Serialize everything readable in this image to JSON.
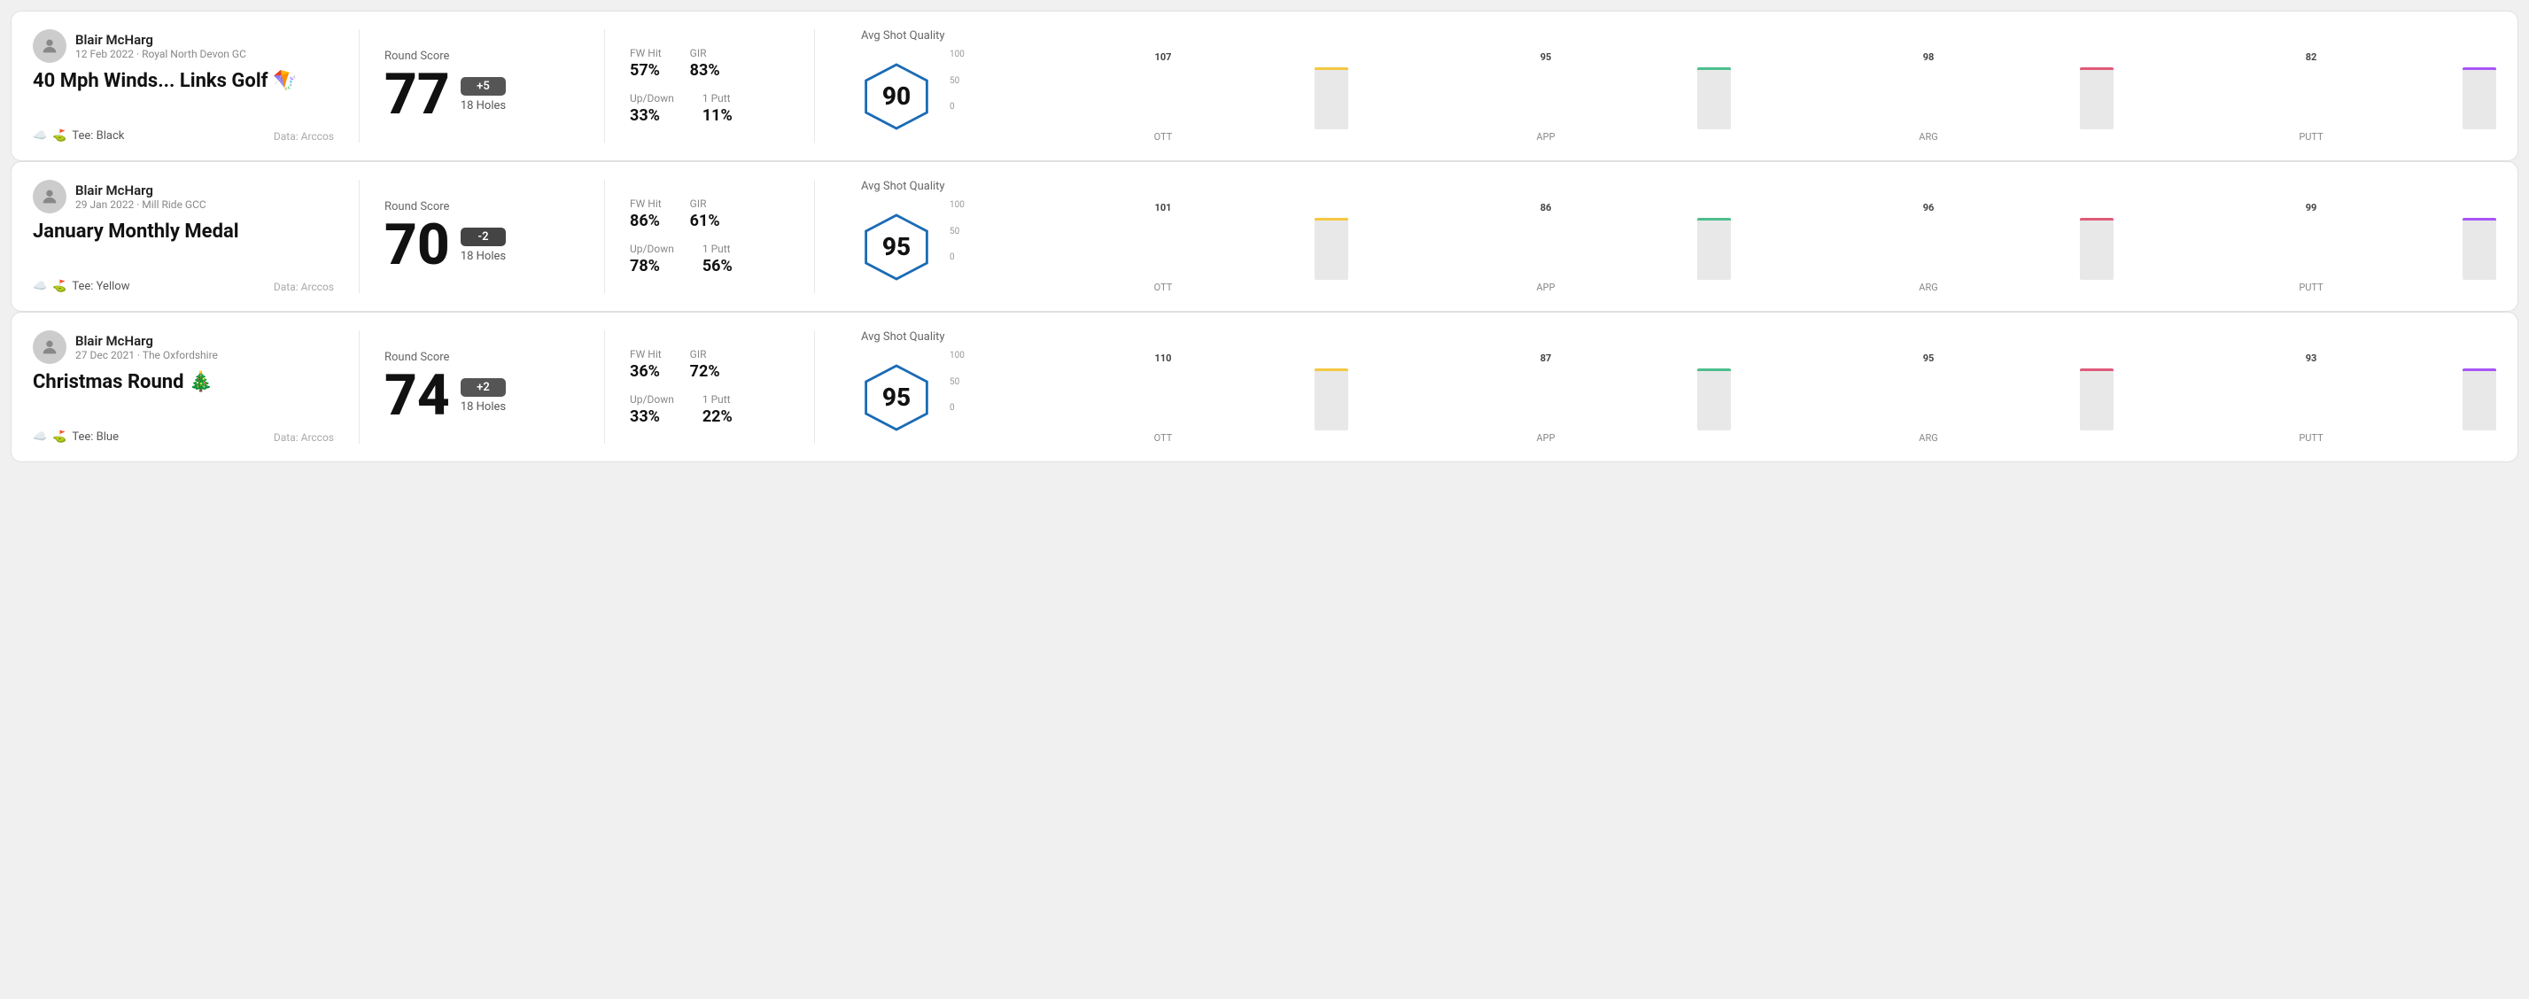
{
  "rounds": [
    {
      "id": "round-1",
      "user": {
        "name": "Blair McHarg",
        "date": "12 Feb 2022",
        "course": "Royal North Devon GC"
      },
      "title": "40 Mph Winds... Links Golf 🪁",
      "tee": "Black",
      "dataSource": "Data: Arccos",
      "score": {
        "label": "Round Score",
        "value": "77",
        "badge": "+5",
        "badgeType": "positive",
        "holes": "18 Holes"
      },
      "stats": {
        "fwHit": {
          "label": "FW Hit",
          "value": "57%"
        },
        "gir": {
          "label": "GIR",
          "value": "83%"
        },
        "upDown": {
          "label": "Up/Down",
          "value": "33%"
        },
        "onePutt": {
          "label": "1 Putt",
          "value": "11%"
        }
      },
      "shotQuality": {
        "label": "Avg Shot Quality",
        "value": "90",
        "bars": [
          {
            "label": "OTT",
            "value": 107,
            "color": "#f5c842"
          },
          {
            "label": "APP",
            "value": 95,
            "color": "#4cbe8c"
          },
          {
            "label": "ARG",
            "value": 98,
            "color": "#e05a7a"
          },
          {
            "label": "PUTT",
            "value": 82,
            "color": "#a855f7"
          }
        ]
      }
    },
    {
      "id": "round-2",
      "user": {
        "name": "Blair McHarg",
        "date": "29 Jan 2022",
        "course": "Mill Ride GCC"
      },
      "title": "January Monthly Medal",
      "tee": "Yellow",
      "dataSource": "Data: Arccos",
      "score": {
        "label": "Round Score",
        "value": "70",
        "badge": "-2",
        "badgeType": "negative",
        "holes": "18 Holes"
      },
      "stats": {
        "fwHit": {
          "label": "FW Hit",
          "value": "86%"
        },
        "gir": {
          "label": "GIR",
          "value": "61%"
        },
        "upDown": {
          "label": "Up/Down",
          "value": "78%"
        },
        "onePutt": {
          "label": "1 Putt",
          "value": "56%"
        }
      },
      "shotQuality": {
        "label": "Avg Shot Quality",
        "value": "95",
        "bars": [
          {
            "label": "OTT",
            "value": 101,
            "color": "#f5c842"
          },
          {
            "label": "APP",
            "value": 86,
            "color": "#4cbe8c"
          },
          {
            "label": "ARG",
            "value": 96,
            "color": "#e05a7a"
          },
          {
            "label": "PUTT",
            "value": 99,
            "color": "#a855f7"
          }
        ]
      }
    },
    {
      "id": "round-3",
      "user": {
        "name": "Blair McHarg",
        "date": "27 Dec 2021",
        "course": "The Oxfordshire"
      },
      "title": "Christmas Round 🎄",
      "tee": "Blue",
      "dataSource": "Data: Arccos",
      "score": {
        "label": "Round Score",
        "value": "74",
        "badge": "+2",
        "badgeType": "positive",
        "holes": "18 Holes"
      },
      "stats": {
        "fwHit": {
          "label": "FW Hit",
          "value": "36%"
        },
        "gir": {
          "label": "GIR",
          "value": "72%"
        },
        "upDown": {
          "label": "Up/Down",
          "value": "33%"
        },
        "onePutt": {
          "label": "1 Putt",
          "value": "22%"
        }
      },
      "shotQuality": {
        "label": "Avg Shot Quality",
        "value": "95",
        "bars": [
          {
            "label": "OTT",
            "value": 110,
            "color": "#f5c842"
          },
          {
            "label": "APP",
            "value": 87,
            "color": "#4cbe8c"
          },
          {
            "label": "ARG",
            "value": 95,
            "color": "#e05a7a"
          },
          {
            "label": "PUTT",
            "value": 93,
            "color": "#a855f7"
          }
        ]
      }
    }
  ],
  "ui": {
    "yAxisLabels": [
      "100",
      "50",
      "0"
    ],
    "teeLabel": "Tee:"
  }
}
